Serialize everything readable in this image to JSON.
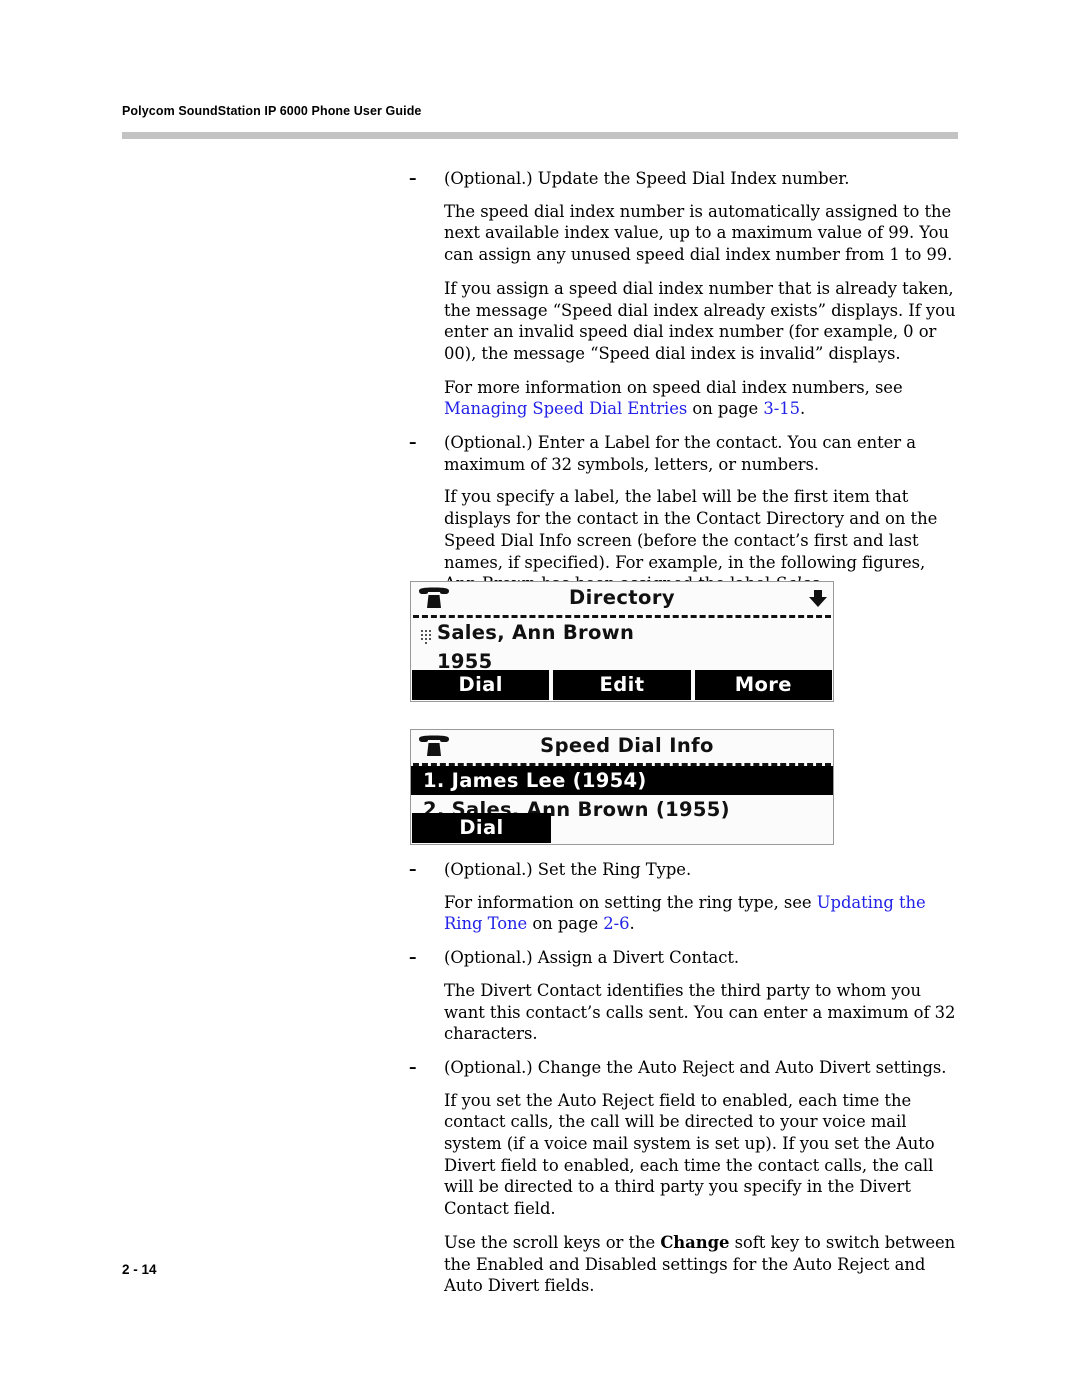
{
  "header": {
    "running_head": "Polycom SoundStation IP 6000 Phone User Guide"
  },
  "footer": {
    "page_number": "2 - 14"
  },
  "colors": {
    "link": "#2222e8",
    "rule": "#c3c3c3",
    "lcd_background": "#fbfbfb",
    "lcd_highlight": "#000000"
  },
  "body": {
    "b1": {
      "dash": "–",
      "text": "(Optional.) Update the Speed Dial Index number."
    },
    "p1": "The speed dial index number is automatically assigned to the next available index value, up to a maximum value of 99. You can assign any unused speed dial index number from 1 to 99.",
    "p2": "If you assign a speed dial index number that is already taken, the message “Speed dial index already exists” displays. If you enter an invalid speed dial index number (for example, 0 or 00), the message “Speed dial index is invalid” displays.",
    "p3": {
      "lead": "For more information on speed dial index numbers, see ",
      "link_text": "Managing Speed Dial Entries",
      "mid": " on page ",
      "link_page": "3-15",
      "end": "."
    },
    "b2": {
      "dash": "–",
      "text": "(Optional.) Enter a Label for the contact. You can enter a maximum of 32 symbols, letters, or numbers."
    },
    "p4": {
      "lead": "If you specify a label, the label will be the first item that displays for the contact in the Contact Directory and on the Speed Dial Info screen (before the contact’s first and last names, if specified). For example, in the following figures, Ann Brown has been assigned the label ",
      "italic": "Sales",
      "end": "."
    },
    "b3": {
      "dash": "–",
      "text": "(Optional.) Set the Ring Type."
    },
    "p5": {
      "lead": "For information on setting the ring type, see ",
      "link_text": "Updating the Ring Tone",
      "mid": " on page ",
      "link_page": "2-6",
      "end": "."
    },
    "b4": {
      "dash": "–",
      "text": "(Optional.) Assign a Divert Contact."
    },
    "p6": "The Divert Contact identifies the third party to whom you want this contact’s calls sent. You can enter a maximum of 32 characters.",
    "b5": {
      "dash": "–",
      "text": "(Optional.) Change the Auto Reject and Auto Divert settings."
    },
    "p7": "If you set the Auto Reject field to enabled, each time the contact calls, the call will be directed to your voice mail system (if a voice mail system is set up). If you set the Auto Divert field to enabled, each time the contact calls, the call will be directed to a third party you specify in the Divert Contact field.",
    "p8": {
      "lead": "Use the scroll keys or the ",
      "bold": "Change",
      "end": " soft key to switch between the Enabled and Disabled settings for the Auto Reject and Auto Divert fields."
    }
  },
  "figures": {
    "directory_screen": {
      "title": "Directory",
      "handset_icon": "handset-onhook-icon",
      "scroll_icon": "scroll-down-arrow-icon",
      "entry_icon": "keypad-dots-icon",
      "entry_label": "Sales, Ann Brown",
      "entry_number": "1955",
      "softkeys": [
        "Dial",
        "Edit",
        "More"
      ]
    },
    "speed_dial_screen": {
      "title": "Speed Dial Info",
      "handset_icon": "handset-onhook-icon",
      "rows": [
        {
          "text": "1. James Lee (1954)",
          "selected": true
        },
        {
          "text": "2. Sales, Ann Brown (1955)",
          "selected": false
        }
      ],
      "softkeys": [
        "Dial"
      ]
    }
  }
}
